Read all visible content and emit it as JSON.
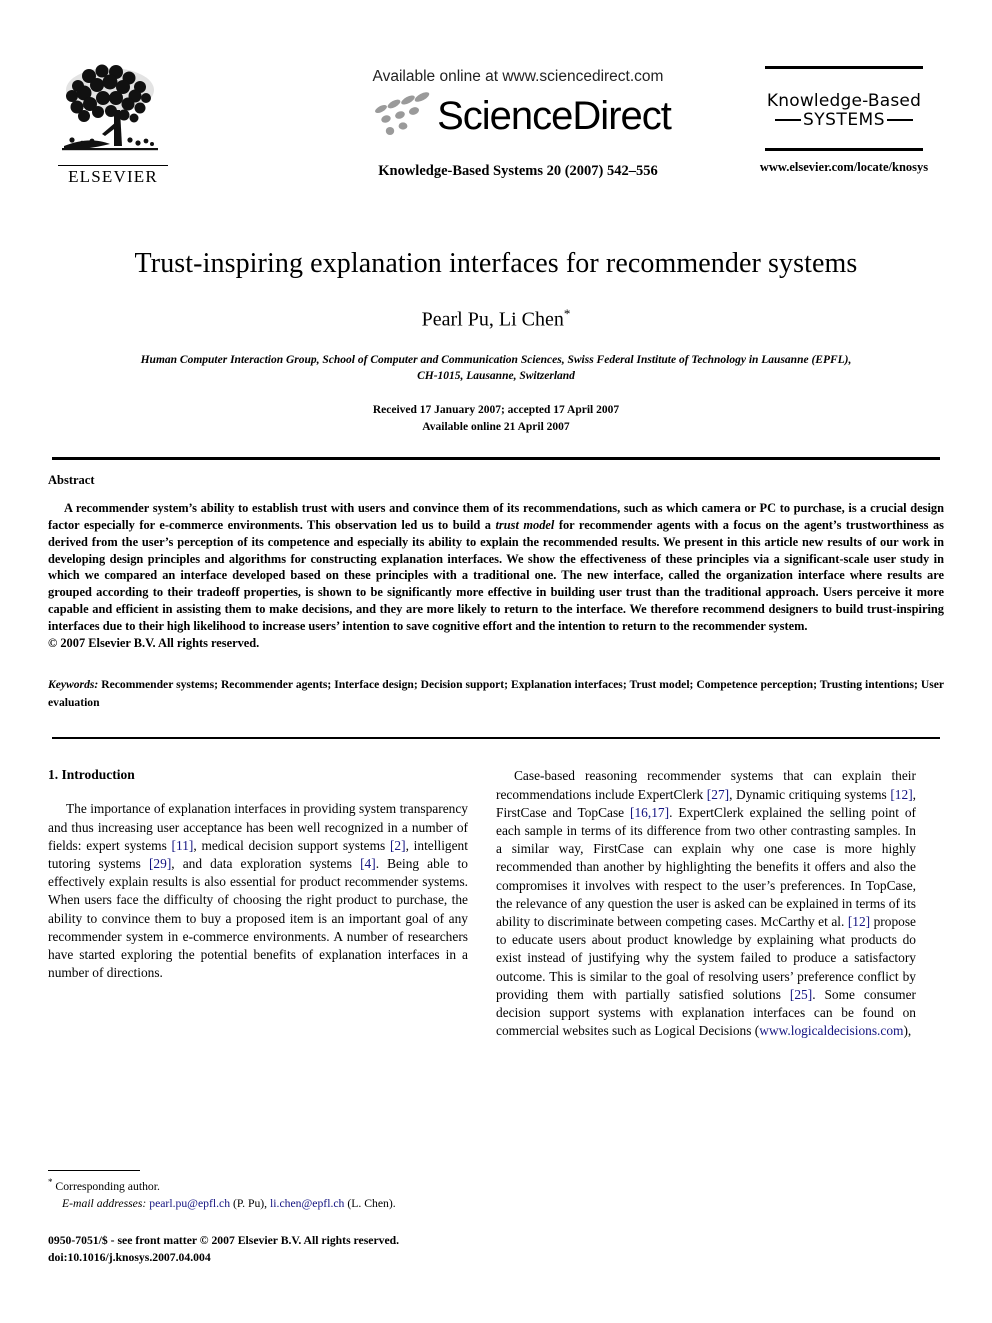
{
  "masthead": {
    "publisher_name": "ELSEVIER",
    "publisher_logo_name": "elsevier-tree-logo",
    "available_online": "Available online at www.sciencedirect.com",
    "sciencedirect_name": "ScienceDirect",
    "journal_citation": "Knowledge-Based Systems 20 (2007) 542–556",
    "journal_logo_line1": "Knowledge-Based",
    "journal_logo_line2": "SYSTEMS",
    "journal_url": "www.elsevier.com/locate/knosys"
  },
  "article": {
    "title": "Trust-inspiring explanation interfaces for recommender systems",
    "authors": "Pearl Pu, Li Chen",
    "corresponding_marker": "*",
    "affiliation_line1": "Human Computer Interaction Group, School of Computer and Communication Sciences, Swiss Federal Institute of Technology in Lausanne (EPFL),",
    "affiliation_line2": "CH-1015, Lausanne, Switzerland",
    "received": "Received 17 January 2007; accepted 17 April 2007",
    "available_online": "Available online 21 April 2007"
  },
  "abstract": {
    "heading": "Abstract",
    "text_part1": "A recommender system’s ability to establish trust with users and convince them of its recommendations, such as which camera or PC to purchase, is a crucial design factor especially for e-commerce environments. This observation led us to build a ",
    "emphasis": "trust model",
    "text_part2": " for recommender agents with a focus on the agent’s trustworthiness as derived from the user’s perception of its competence and especially its ability to explain the recommended results. We present in this article new results of our work in developing design principles and algorithms for constructing explanation interfaces. We show the effectiveness of these principles via a significant-scale user study in which we compared an interface developed based on these principles with a traditional one. The new interface, called the organization interface where results are grouped according to their tradeoff properties, is shown to be significantly more effective in building user trust than the traditional approach. Users perceive it more capable and efficient in assisting them to make decisions, and they are more likely to return to the interface. We therefore recommend designers to build trust-inspiring interfaces due to their high likelihood to increase users’ intention to save cognitive effort and the intention to return to the recommender system.",
    "copyright": "© 2007 Elsevier B.V. All rights reserved.",
    "keywords_label": "Keywords:",
    "keywords_text": " Recommender systems; Recommender agents; Interface design; Decision support; Explanation interfaces; Trust model; Competence perception; Trusting intentions; User evaluation"
  },
  "body": {
    "section_heading": "1. Introduction",
    "left_paragraph": {
      "s1": "The importance of explanation interfaces in providing system transparency and thus increasing user acceptance has been well recognized in a number of fields: expert systems ",
      "r1": "[11]",
      "s2": ", medical decision support systems ",
      "r2": "[2]",
      "s3": ", intelligent tutoring systems ",
      "r3": "[29]",
      "s4": ", and data exploration systems ",
      "r4": "[4]",
      "s5": ". Being able to effectively explain results is also essential for product recommender systems. When users face the difficulty of choosing the right product to purchase, the ability to convince them to buy a proposed item is an important goal of any recommender system in e-commerce environments. A number of researchers have started exploring the potential benefits of explanation interfaces in a number of directions."
    },
    "right_paragraph": {
      "s1": "Case-based reasoning recommender systems that can explain their recommendations include ExpertClerk ",
      "r1": "[27]",
      "s2": ", Dynamic critiquing systems ",
      "r2": "[12]",
      "s3": ", FirstCase and TopCase ",
      "r3": "[16,17]",
      "s4": ". ExpertClerk explained the selling point of each sample in terms of its difference from two other contrasting samples. In a similar way, FirstCase can explain why one case is more highly recommended than another by highlighting the benefits it offers and also the compromises it involves with respect to the user’s preferences. In TopCase, the relevance of any question the user is asked can be explained in terms of its ability to discriminate between competing cases. McCarthy et al. ",
      "r4": "[12]",
      "s5": " propose to educate users about product knowledge by explaining what products do exist instead of justifying why the system failed to produce a satisfactory outcome. This is similar to the goal of resolving users’ preference conflict by providing them with partially satisfied solutions ",
      "r5": "[25]",
      "s6": ". Some consumer decision support systems with explanation interfaces can be found on commercial websites such as Logical Decisions (",
      "link1": "www.logicaldecisions.com",
      "s7": "),"
    }
  },
  "footnote": {
    "star": "*",
    "corresponding_author": "Corresponding author.",
    "email_label": "E-mail addresses:",
    "email1": "pearl.pu@epfl.ch",
    "email1_owner": " (P. Pu), ",
    "email2": "li.chen@epfl.ch",
    "email2_owner": " (L. Chen)."
  },
  "imprint": {
    "line1": "0950-7051/$ - see front matter © 2007 Elsevier B.V. All rights reserved.",
    "line2": "doi:10.1016/j.knosys.2007.04.004"
  },
  "colors": {
    "link": "#131380",
    "text": "#000000",
    "logo_gray": "#9a9a9a"
  }
}
